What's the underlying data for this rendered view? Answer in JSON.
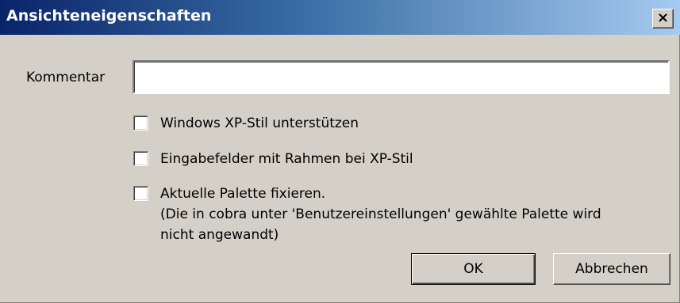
{
  "window": {
    "title": "Ansichteneigenschaften",
    "close_label": "×"
  },
  "comment": {
    "label": "Kommentar",
    "value": ""
  },
  "options": [
    {
      "label": "Windows XP-Stil unterstützen",
      "checked": false
    },
    {
      "label": "Eingabefelder mit Rahmen bei XP-Stil",
      "checked": false
    },
    {
      "label": "Aktuelle Palette fixieren.",
      "note_line1": "(Die in cobra unter 'Benutzereinstellungen' gewählte Palette wird",
      "note_line2": "nicht angewandt)",
      "checked": false
    }
  ],
  "buttons": {
    "ok_label": "OK",
    "cancel_label": "Abbrechen"
  },
  "colors": {
    "dialog_background": "#d4d0c8",
    "titlebar_start": "#0a246a",
    "titlebar_end": "#a6caf0"
  }
}
